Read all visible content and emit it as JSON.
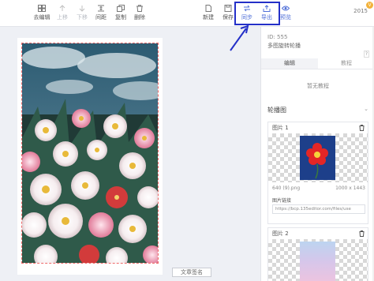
{
  "toolbar": {
    "items": [
      {
        "label": "去编辑",
        "icon": "grid-icon",
        "enabled": true
      },
      {
        "label": "上移",
        "icon": "arrow-up-icon",
        "enabled": false
      },
      {
        "label": "下移",
        "icon": "arrow-down-icon",
        "enabled": false
      },
      {
        "label": "间距",
        "icon": "spacing-icon",
        "enabled": true
      },
      {
        "label": "复制",
        "icon": "copy-icon",
        "enabled": true
      },
      {
        "label": "删除",
        "icon": "trash-icon",
        "enabled": true
      }
    ],
    "right_items": [
      {
        "label": "新建",
        "icon": "new-file-icon"
      },
      {
        "label": "保存",
        "icon": "save-icon"
      },
      {
        "label": "同步",
        "icon": "sync-icon"
      },
      {
        "label": "导出",
        "icon": "export-icon"
      },
      {
        "label": "预览",
        "icon": "eye-icon"
      }
    ],
    "version": "2015"
  },
  "editor": {
    "sign_label": "文章签名"
  },
  "panel": {
    "id_text": "ID: 555",
    "component_name": "多图旋转轮播",
    "help": "?",
    "tabs": [
      "编辑",
      "教程"
    ],
    "no_tutorial": "暂无教程",
    "section_title": "轮播图",
    "images": [
      {
        "label": "图片 1",
        "file_name": "640 (9).png",
        "dimensions": "1000 x 1443",
        "link_label": "图片链接",
        "link_value": "https://bcp.135editor.com/files/use"
      },
      {
        "label": "图片 2"
      }
    ]
  },
  "colors": {
    "accent": "#4f6fd8",
    "highlight_box": "#2430c8",
    "selection_border": "#ef6b6b"
  }
}
